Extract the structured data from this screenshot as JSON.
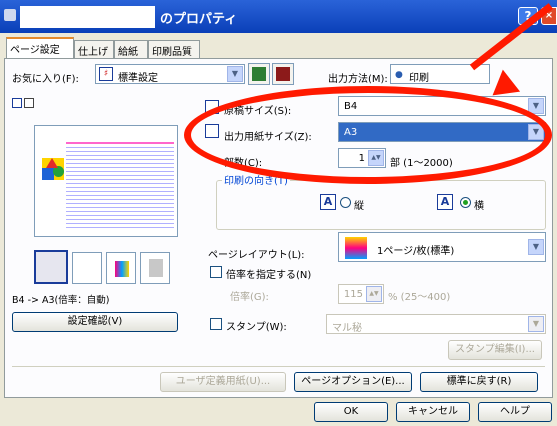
{
  "window": {
    "title": "のプロパティ",
    "help": "?"
  },
  "tabs": [
    "ページ設定",
    "仕上げ",
    "給紙",
    "印刷品質"
  ],
  "favorites": {
    "label": "お気に入り(F):",
    "value": "標準設定"
  },
  "output": {
    "label": "出力方法(M):",
    "value": "印刷"
  },
  "page_size": {
    "label": "原稿サイズ(S):",
    "value": "B4"
  },
  "paper_size": {
    "label": "出力用紙サイズ(Z):",
    "value": "A3"
  },
  "copies": {
    "label": "部数(C):",
    "value": "1",
    "unit": "部 (1～2000)"
  },
  "orientation": {
    "label": "印刷の向き(T)",
    "portrait": "縦",
    "landscape": "横",
    "icon_letter": "A"
  },
  "layout": {
    "label": "ページレイアウト(L):",
    "value": "1ページ/枚(標準)"
  },
  "zoom": {
    "check_label": "倍率を指定する(N)",
    "label": "倍率(G):",
    "value": "115",
    "unit": "% (25～400)"
  },
  "preview_caption": "B4 -> A3(倍率：自動)",
  "confirm_button": "設定確認(V)",
  "stamp": {
    "check_label": "スタンプ(W):",
    "value": "マル秘",
    "edit_button": "スタンプ編集(I)..."
  },
  "bottom_buttons": {
    "custom_paper": "ユーザ定義用紙(U)...",
    "page_options": "ページオプション(E)...",
    "restore": "標準に戻す(R)"
  },
  "dialog_buttons": {
    "ok": "OK",
    "cancel": "キャンセル",
    "help": "ヘルプ"
  }
}
